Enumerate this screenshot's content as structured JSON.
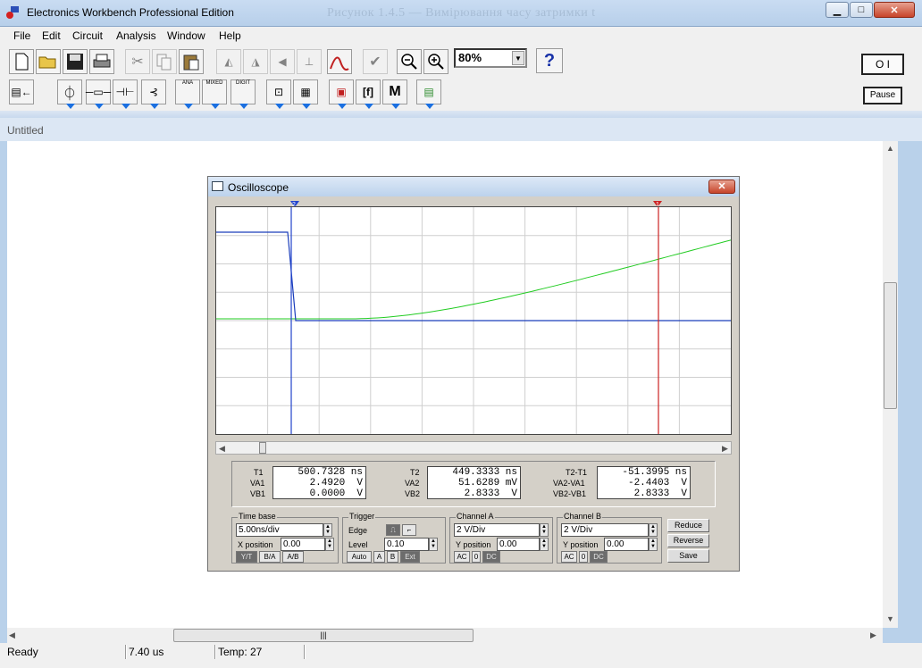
{
  "window": {
    "title": "Electronics Workbench Professional Edition",
    "ghost_title": "Рисунок 1.4.5 — Вимірювання часу затримки t",
    "close_glyph": "✕",
    "min_glyph": "▭",
    "max_glyph": "□"
  },
  "menu": [
    "File",
    "Edit",
    "Circuit",
    "Analysis",
    "Window",
    "Help"
  ],
  "toolbar": {
    "zoom_value": "80%",
    "help_label": "?",
    "pause_label": "Pause",
    "power_label": "O I",
    "parts_labels": [
      "ANA",
      "MIXED",
      "DIGIT",
      "M"
    ]
  },
  "document": {
    "title": "Untitled"
  },
  "status": {
    "state": "Ready",
    "time": "7.40 us",
    "temp": "Temp: 27"
  },
  "oscilloscope": {
    "title": "Oscilloscope",
    "cursor1_label": "1",
    "cursor2_label": "2",
    "readouts": {
      "t1_label": "T1",
      "t1": "500.7328 ns",
      "va1_label": "VA1",
      "va1": "2.4920  V",
      "vb1_label": "VB1",
      "vb1": "0.0000  V",
      "t2_label": "T2",
      "t2": "449.3333 ns",
      "va2_label": "VA2",
      "va2": "51.6289 mV",
      "vb2_label": "VB2",
      "vb2": "2.8333  V",
      "dt_label": "T2-T1",
      "dt": "-51.3995 ns",
      "dva_label": "VA2-VA1",
      "dva": "-2.4403  V",
      "dvb_label": "VB2-VB1",
      "dvb": "2.8333  V"
    },
    "timebase": {
      "label": "Time base",
      "value": "5.00ns/div",
      "xpos_label": "X position",
      "xpos": "0.00",
      "modes": [
        "Y/T",
        "B/A",
        "A/B"
      ]
    },
    "trigger": {
      "label": "Trigger",
      "edge_label": "Edge",
      "level_label": "Level",
      "level": "0.10",
      "sources": [
        "Auto",
        "A",
        "B",
        "Ext"
      ]
    },
    "channel_a": {
      "label": "Channel A",
      "scale": "2 V/Div",
      "ypos_label": "Y position",
      "ypos": "0.00",
      "coupling": [
        "AC",
        "0",
        "DC"
      ]
    },
    "channel_b": {
      "label": "Channel B",
      "scale": "2 V/Div",
      "ypos_label": "Y position",
      "ypos": "0.00",
      "coupling": [
        "AC",
        "0",
        "DC"
      ]
    },
    "buttons": {
      "reduce": "Reduce",
      "reverse": "Reverse",
      "save": "Save"
    },
    "colors": {
      "channel_a": "#22cc22",
      "channel_b": "#1a3dbb",
      "cursor1": "#cc2222",
      "cursor2": "#2244cc"
    }
  }
}
